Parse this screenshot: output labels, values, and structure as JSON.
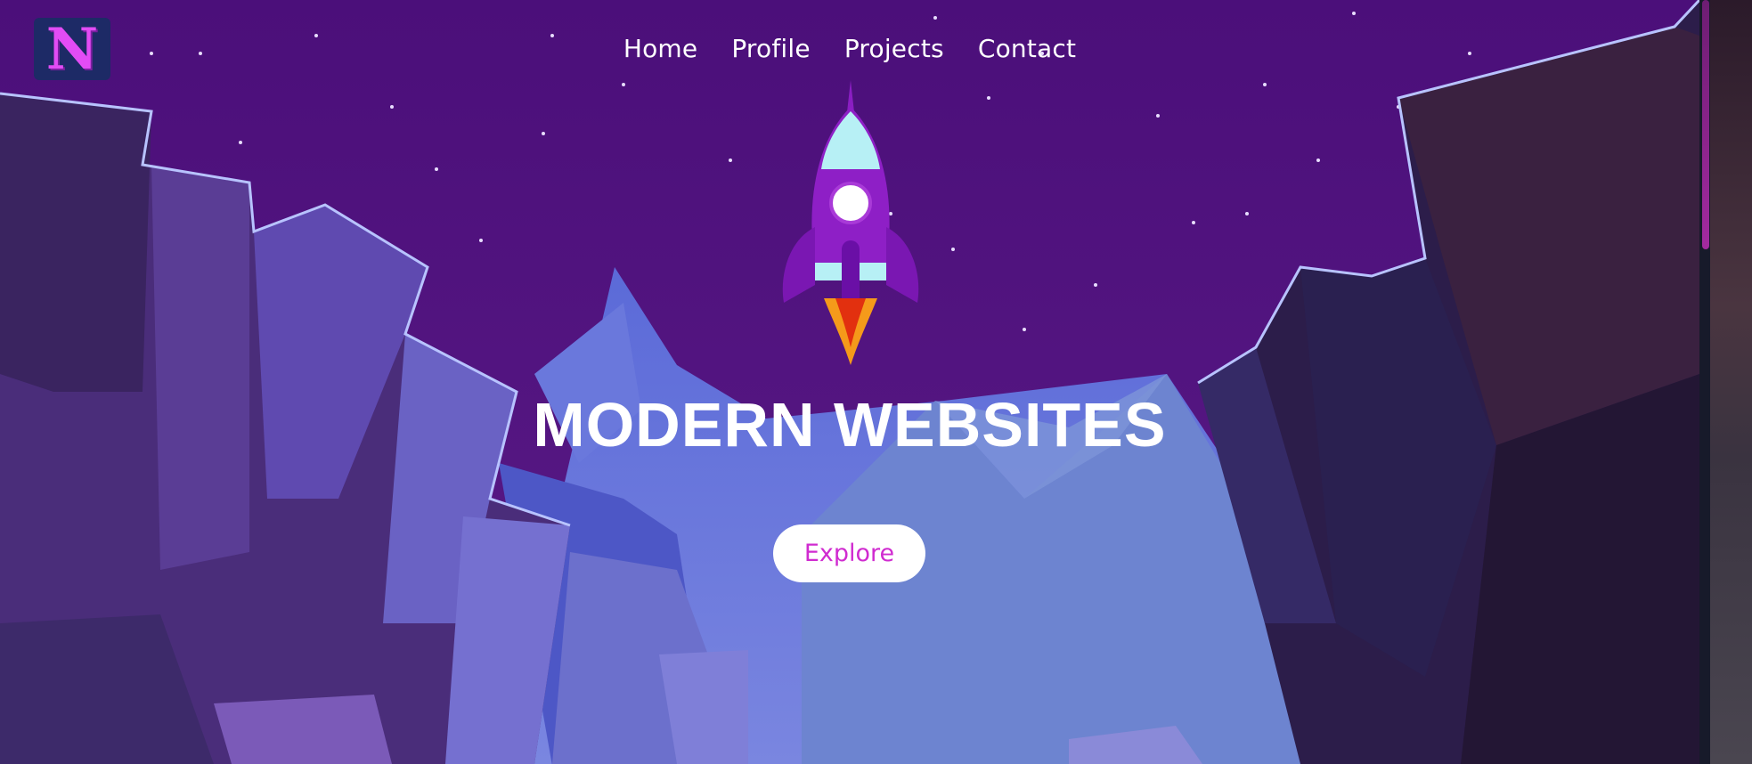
{
  "logo": {
    "letter": "N"
  },
  "nav": {
    "items": [
      "Home",
      "Profile",
      "Projects",
      "Contact"
    ]
  },
  "hero": {
    "title": "MODERN WEBSITES",
    "button_label": "Explore"
  },
  "colors": {
    "sky": "#4a1278",
    "accent": "#d02bd0",
    "logo_bg": "#1d2a66"
  }
}
